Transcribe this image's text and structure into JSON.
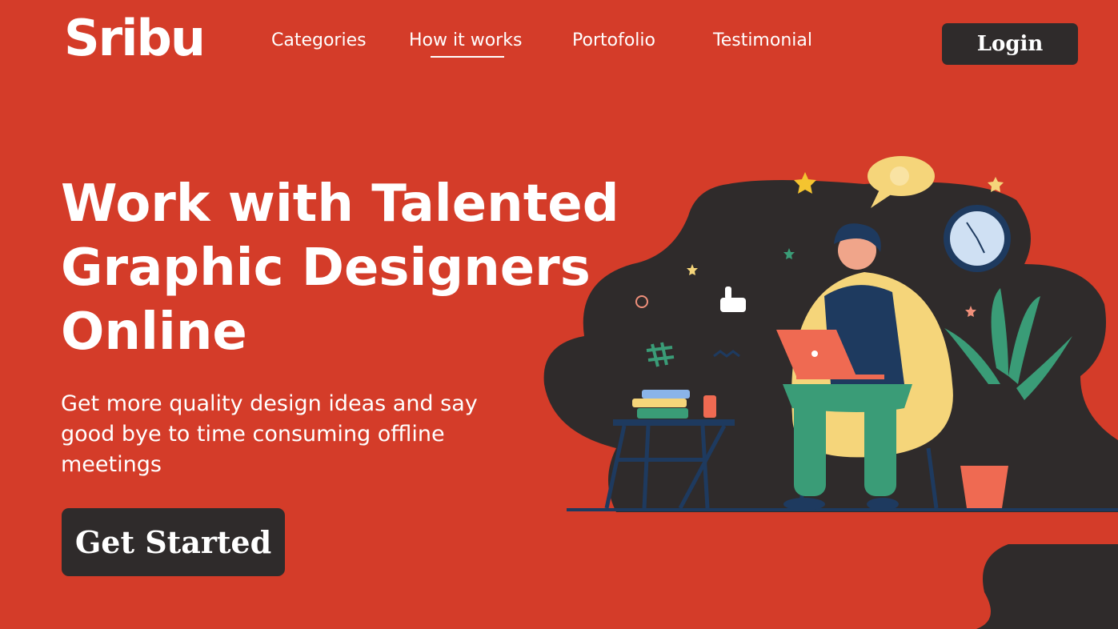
{
  "brand": {
    "logo_text": "Sribu"
  },
  "nav": {
    "items": [
      {
        "label": "Categories"
      },
      {
        "label": "How it works",
        "active": true
      },
      {
        "label": "Portofolio"
      },
      {
        "label": "Testimonial"
      }
    ],
    "login_label": "Login"
  },
  "hero": {
    "title_lines": [
      "Work with Talented",
      "Graphic Designers",
      "Online"
    ],
    "subtitle": "Get more quality design ideas and say good bye to time consuming offline meetings",
    "cta_label": "Get Started"
  },
  "colors": {
    "background": "#d43c29",
    "dark": "#2f2b2b",
    "accent_yellow": "#f5d57a",
    "teal": "#3a9c77",
    "navy": "#1e3a5f"
  },
  "icons": [
    "star-icon",
    "thumbs-up-icon",
    "hashtag-icon",
    "clock-icon",
    "speech-bubble-icon",
    "laptop-icon",
    "plant-icon"
  ]
}
